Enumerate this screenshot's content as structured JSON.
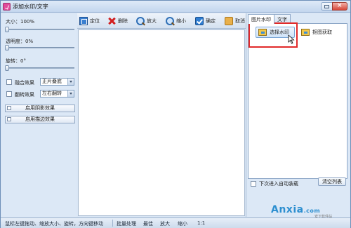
{
  "window": {
    "title": "添加水印/文字"
  },
  "left": {
    "size_label": "大小：100%",
    "opacity_label": "透明度：0%",
    "rotation_label": "旋转：0°",
    "sliders": {
      "size": 0.0,
      "opacity": 0.0,
      "rotation": 0.0
    },
    "blend": {
      "label": "融合效果",
      "value": "正片叠底"
    },
    "flip": {
      "label": "翻转效果",
      "value": "左右翻转"
    },
    "shadow_btn": "启用阴影效果",
    "stroke_btn": "启用描边效果"
  },
  "toolbar": {
    "locate": "定位",
    "delete": "删除",
    "zoom_in": "放大",
    "zoom_out": "缩小",
    "ok": "确定",
    "cancel": "取消"
  },
  "right": {
    "tabs": [
      "图片水印",
      "文字"
    ],
    "select_btn": "选择水印",
    "pick_btn": "抠图获取",
    "auto_load": "下次进入自动装载",
    "clear_btn": "清空列表"
  },
  "status": {
    "hint": "鼠标左键拖动、缩放大小、旋转，方向键移动",
    "batch": "批量处理",
    "best": "最佳",
    "zoom_in": "放大",
    "zoom_out": "缩小",
    "ratio": "1:1"
  },
  "brand": {
    "name": "Anxia",
    "domain": ".com",
    "sub": "安下软件站"
  },
  "colors": {
    "highlight": "#e12a2a",
    "delete_icon": "#d21f1f",
    "brand": "#2d8fd0"
  }
}
